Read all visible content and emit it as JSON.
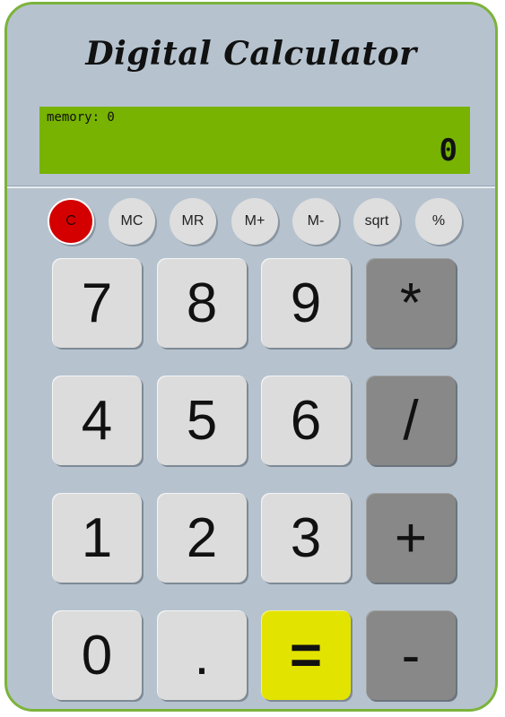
{
  "title": "Digital Calculator",
  "display": {
    "memory_label": "memory: 0",
    "value": "0"
  },
  "function_keys": {
    "clear": "C",
    "mc": "MC",
    "mr": "MR",
    "m_plus": "M+",
    "m_minus": "M-",
    "sqrt": "sqrt",
    "percent": "%"
  },
  "keys": {
    "seven": "7",
    "eight": "8",
    "nine": "9",
    "multiply": "*",
    "four": "4",
    "five": "5",
    "six": "6",
    "divide": "/",
    "one": "1",
    "two": "2",
    "three": "3",
    "plus": "+",
    "zero": "0",
    "decimal": ".",
    "equals": "=",
    "minus": "-"
  },
  "colors": {
    "body": "#b6c3cf",
    "border": "#7cb33b",
    "display": "#77b300",
    "clear_key": "#d40000",
    "operator_key": "#888888",
    "equals_key": "#e3e300",
    "digit_key": "#dcdcdc"
  }
}
